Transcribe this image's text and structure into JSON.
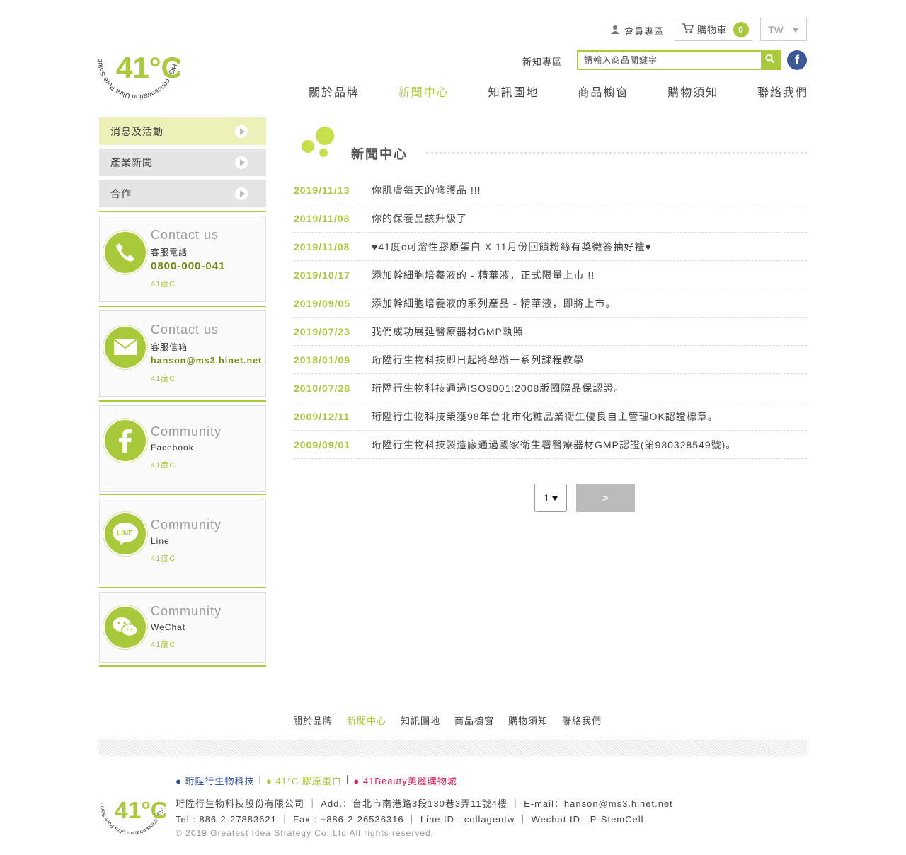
{
  "header": {
    "logo_text": "41°C",
    "logo_ring": "High concentration Ultra Pure Soluble Collagen",
    "member": "會員專區",
    "cart_label": "購物車",
    "cart_count": "0",
    "lang": "TW",
    "news_link": "新知專區",
    "search_placeholder": "請輸入商品關鍵字",
    "fb": "f"
  },
  "nav": [
    "關於品牌",
    "新聞中心",
    "知訊園地",
    "商品櫥窗",
    "購物須知",
    "聯絡我們"
  ],
  "sidebar": {
    "items": [
      "消息及活動",
      "產業新聞",
      "合作"
    ],
    "boxes": [
      {
        "title": "Contact us",
        "sub": "客服電話",
        "value": "0800-000-041",
        "brand": "41度C"
      },
      {
        "title": "Contact us",
        "sub": "客服信箱",
        "value": "hanson@ms3.hinet.net",
        "brand": "41度C"
      },
      {
        "title": "Community",
        "sub": "Facebook",
        "brand": "41度C"
      },
      {
        "title": "Community",
        "sub": "Line",
        "brand": "41度C"
      },
      {
        "title": "Community",
        "sub": "WeChat",
        "brand": "41度C"
      }
    ]
  },
  "main": {
    "title": "新聞中心",
    "news": [
      {
        "date": "2019/11/13",
        "title": "你肌膚每天的修護品 !!!"
      },
      {
        "date": "2019/11/08",
        "title": "你的保養品該升級了"
      },
      {
        "date": "2019/11/08",
        "title": "♥41度c可溶性膠原蛋白 X 11月份回饋粉絲有獎徵答抽好禮♥"
      },
      {
        "date": "2019/10/17",
        "title": "添加幹細胞培養液的 - 精華液，正式限量上市 !!"
      },
      {
        "date": "2019/09/05",
        "title": "添加幹細胞培養液的系列產品 - 精華液，即將上市。"
      },
      {
        "date": "2019/07/23",
        "title": "我們成功展延醫療器材GMP執照"
      },
      {
        "date": "2018/01/09",
        "title": "珩陞行生物科技即日起將舉辦一系列課程教學"
      },
      {
        "date": "2010/07/28",
        "title": "珩陞行生物科技通過ISO9001:2008版國際品保認證。"
      },
      {
        "date": "2009/12/11",
        "title": "珩陞行生物科技榮獲98年台北市化粧品業衛生優良自主管理OK認證標章。"
      },
      {
        "date": "2009/09/01",
        "title": "珩陞行生物科技製造廠通過國家衛生署醫療器材GMP認證(第980328549號)。"
      }
    ],
    "page_value": "1",
    "next_label": ">"
  },
  "footer": {
    "nav": [
      "關於品牌",
      "新聞中心",
      "知訊園地",
      "商品櫥窗",
      "購物須知",
      "聯絡我們"
    ],
    "link1": "● 珩陞行生物科技",
    "link2": "● 41°C 膠原蛋白",
    "link3": "● 41Beauty美麗購物城",
    "sep": "|",
    "line1": "珩陞行生物科技股份有限公司 ｜ Add.：台北市南港路3段130巷3弄11號4樓 ｜ E-mail：hanson@ms3.hinet.net",
    "line2": "Tel : 886-2-27883621 ｜ Fax : +886-2-26536316 ｜ Line ID : collagentw ｜ Wechat ID : P-StemCell",
    "copyright": "© 2019 Greatest Idea Strategy Co.,Ltd All rights reserved."
  },
  "colors": {
    "accent": "#a8c93a",
    "facebook": "#3b5998",
    "link_blue": "#2b4ea8",
    "link_pink": "#d8195b"
  }
}
